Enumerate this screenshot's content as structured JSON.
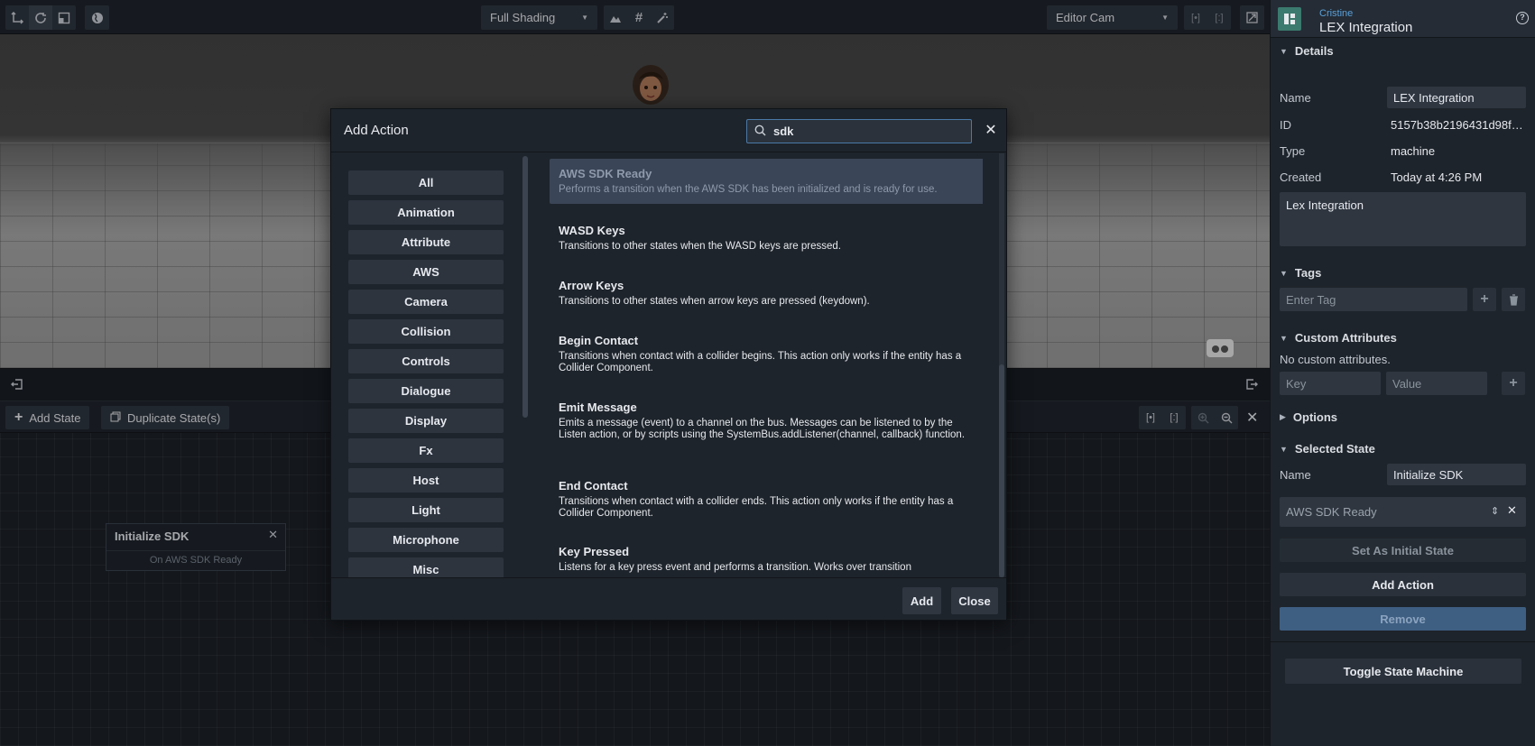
{
  "toolbar": {
    "shading": "Full Shading",
    "camera": "Editor Cam"
  },
  "state_toolbar": {
    "add_state": "Add State",
    "duplicate_state": "Duplicate State(s)"
  },
  "state_node": {
    "title": "Initialize SDK",
    "action": "On AWS SDK Ready"
  },
  "modal": {
    "title": "Add Action",
    "search_value": "sdk",
    "categories": [
      "All",
      "Animation",
      "Attribute",
      "AWS",
      "Camera",
      "Collision",
      "Controls",
      "Dialogue",
      "Display",
      "Fx",
      "Host",
      "Light",
      "Microphone",
      "Misc"
    ],
    "actions": [
      {
        "title": "AWS SDK Ready",
        "desc": "Performs a transition when the AWS SDK has been initialized and is ready for use."
      },
      {
        "title": "WASD Keys",
        "desc": "Transitions to other states when the WASD keys are pressed."
      },
      {
        "title": "Arrow Keys",
        "desc": "Transitions to other states when arrow keys are pressed (keydown)."
      },
      {
        "title": "Begin Contact",
        "desc": "Transitions when contact with a collider begins. This action only works if the entity has a Collider Component."
      },
      {
        "title": "Emit Message",
        "desc": "Emits a message (event) to a channel on the bus. Messages can be listened to by the Listen action, or by scripts using the SystemBus.addListener(channel, callback) function."
      },
      {
        "title": "End Contact",
        "desc": "Transitions when contact with a collider ends. This action only works if the entity has a Collider Component."
      },
      {
        "title": "Key Pressed",
        "desc": "Listens for a key press event and performs a transition. Works over transition"
      }
    ],
    "add_button": "Add",
    "close_button": "Close"
  },
  "panel": {
    "owner": "Cristine",
    "title": "LEX Integration",
    "details": {
      "heading": "Details",
      "name_label": "Name",
      "name_value": "LEX Integration",
      "id_label": "ID",
      "id_value": "5157b38b2196431d98f…",
      "type_label": "Type",
      "type_value": "machine",
      "created_label": "Created",
      "created_value": "Today at 4:26 PM",
      "description": "Lex Integration"
    },
    "tags": {
      "heading": "Tags",
      "placeholder": "Enter Tag"
    },
    "custom_attributes": {
      "heading": "Custom Attributes",
      "empty": "No custom attributes.",
      "key_placeholder": "Key",
      "value_placeholder": "Value"
    },
    "options": {
      "heading": "Options"
    },
    "selected_state": {
      "heading": "Selected State",
      "name_label": "Name",
      "name_value": "Initialize SDK",
      "action": "AWS SDK Ready",
      "set_initial": "Set As Initial State",
      "add_action": "Add Action",
      "remove": "Remove"
    },
    "toggle": "Toggle State Machine"
  }
}
